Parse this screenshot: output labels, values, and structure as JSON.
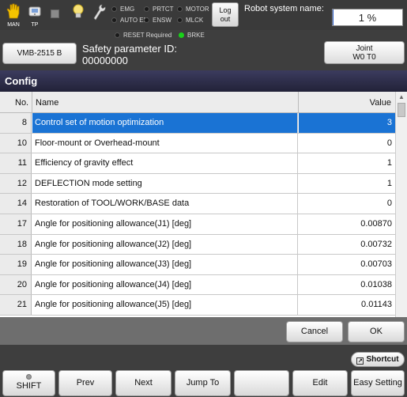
{
  "status_bar": {
    "man_label": "MAN",
    "tp_label": "TP",
    "indicators": {
      "emg": "EMG",
      "prtct": "PRTCT",
      "motor": "MOTOR",
      "auto_en": "AUTO EN",
      "ensw": "ENSW",
      "mlck": "MLCK",
      "reset_required": "RESET Required",
      "brke": "BRKE"
    },
    "logout_label_line1": "Log",
    "logout_label_line2": "out",
    "robot_system_name_label": "Robot system name:",
    "progress_text": "1 %",
    "progress_percent": 1
  },
  "header": {
    "robot_button": "VMB-2515 B",
    "safety_label": "Safety parameter ID:",
    "safety_value": "00000000",
    "joint_line1": "Joint",
    "joint_line2": "W0 T0"
  },
  "title": "Config",
  "table": {
    "col_no": "No.",
    "col_name": "Name",
    "col_value": "Value",
    "rows": [
      {
        "no": "8",
        "name": "Control set of motion optimization",
        "value": "3"
      },
      {
        "no": "10",
        "name": "Floor-mount or Overhead-mount",
        "value": "0"
      },
      {
        "no": "11",
        "name": "Efficiency of gravity effect",
        "value": "1"
      },
      {
        "no": "12",
        "name": "DEFLECTION mode setting",
        "value": "1"
      },
      {
        "no": "14",
        "name": "Restoration of TOOL/WORK/BASE data",
        "value": "0"
      },
      {
        "no": "17",
        "name": "Angle for positioning allowance(J1) [deg]",
        "value": "0.00870"
      },
      {
        "no": "18",
        "name": "Angle for positioning allowance(J2) [deg]",
        "value": "0.00732"
      },
      {
        "no": "19",
        "name": "Angle for positioning allowance(J3) [deg]",
        "value": "0.00703"
      },
      {
        "no": "20",
        "name": "Angle for positioning allowance(J4) [deg]",
        "value": "0.01038"
      },
      {
        "no": "21",
        "name": "Angle for positioning allowance(J5) [deg]",
        "value": "0.01143"
      }
    ]
  },
  "buttons": {
    "cancel": "Cancel",
    "ok": "OK",
    "shortcut": "Shortcut"
  },
  "function_keys": {
    "shift": "SHIFT",
    "prev": "Prev",
    "next": "Next",
    "jump_to": "Jump To",
    "blank": "",
    "edit": "Edit",
    "easy_setting": "Easy Setting"
  },
  "colors": {
    "selected_row": "#1a73d4",
    "title_bar": "#2c2c48",
    "brke_on": "#19d219"
  }
}
